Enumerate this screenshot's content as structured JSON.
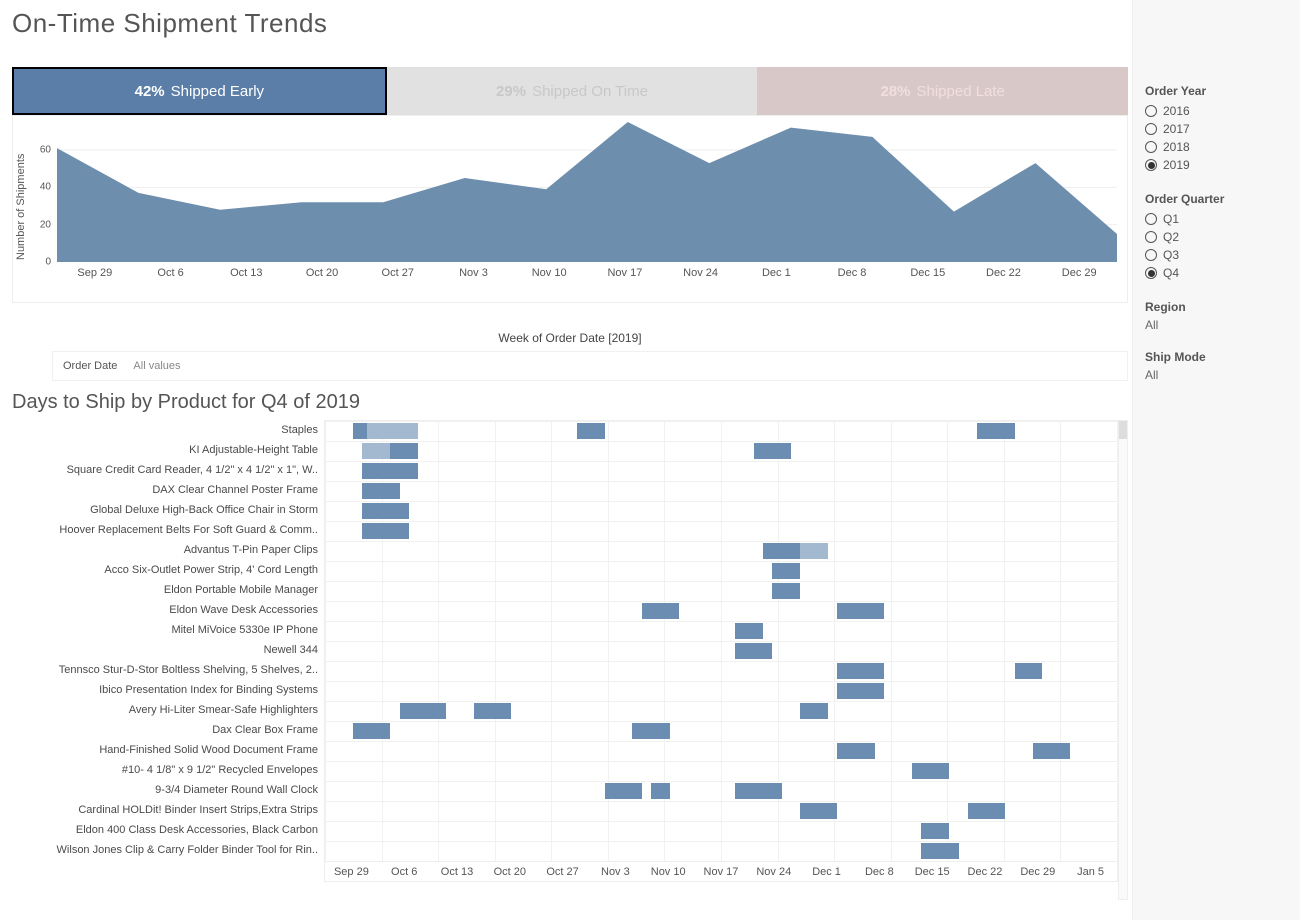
{
  "title": "On-Time Shipment Trends",
  "kpis": {
    "early": {
      "pct": "42%",
      "label": "Shipped Early"
    },
    "ontime": {
      "pct": "29%",
      "label": "Shipped On Time"
    },
    "late": {
      "pct": "28%",
      "label": "Shipped Late"
    }
  },
  "area": {
    "y_title": "Number of Shipments",
    "x_title": "Week of Order Date [2019]",
    "y_ticks": [
      "0",
      "20",
      "40",
      "60"
    ],
    "x_ticks": [
      "Sep 29",
      "Oct 6",
      "Oct 13",
      "Oct 20",
      "Oct 27",
      "Nov 3",
      "Nov 10",
      "Nov 17",
      "Nov 24",
      "Dec 1",
      "Dec 8",
      "Dec 15",
      "Dec 22",
      "Dec 29"
    ]
  },
  "order_date": {
    "label": "Order Date",
    "value": "All values"
  },
  "subtitle": "Days to Ship by Product for Q4 of 2019",
  "gantt_x_ticks": [
    "Sep 29",
    "Oct 6",
    "Oct 13",
    "Oct 20",
    "Oct 27",
    "Nov 3",
    "Nov 10",
    "Nov 17",
    "Nov 24",
    "Dec 1",
    "Dec 8",
    "Dec 15",
    "Dec 22",
    "Dec 29",
    "Jan 5"
  ],
  "gantt": [
    {
      "label": "Staples",
      "bars": [
        {
          "x": 3,
          "w": 6
        },
        {
          "x": 4.5,
          "w": 5.5,
          "light": true
        },
        {
          "x": 27,
          "w": 3
        },
        {
          "x": 70,
          "w": 4
        }
      ]
    },
    {
      "label": "KI Adjustable-Height Table",
      "bars": [
        {
          "x": 4,
          "w": 3,
          "light": true
        },
        {
          "x": 7,
          "w": 3
        },
        {
          "x": 46,
          "w": 4
        }
      ]
    },
    {
      "label": "Square Credit Card Reader, 4 1/2\" x 4 1/2\" x 1\", W..",
      "bars": [
        {
          "x": 4,
          "w": 6
        }
      ]
    },
    {
      "label": "DAX Clear Channel Poster Frame",
      "bars": [
        {
          "x": 4,
          "w": 4
        }
      ]
    },
    {
      "label": "Global Deluxe High-Back Office Chair in Storm",
      "bars": [
        {
          "x": 4,
          "w": 5
        }
      ]
    },
    {
      "label": "Hoover Replacement Belts For Soft Guard & Comm..",
      "bars": [
        {
          "x": 4,
          "w": 5
        }
      ]
    },
    {
      "label": "Advantus T-Pin Paper Clips",
      "bars": [
        {
          "x": 47,
          "w": 4
        },
        {
          "x": 51,
          "w": 3,
          "light": true
        }
      ]
    },
    {
      "label": "Acco Six-Outlet Power Strip, 4' Cord Length",
      "bars": [
        {
          "x": 48,
          "w": 3
        }
      ]
    },
    {
      "label": "Eldon Portable Mobile Manager",
      "bars": [
        {
          "x": 48,
          "w": 3
        }
      ]
    },
    {
      "label": "Eldon Wave Desk Accessories",
      "bars": [
        {
          "x": 34,
          "w": 4
        },
        {
          "x": 55,
          "w": 5
        }
      ]
    },
    {
      "label": "Mitel MiVoice 5330e IP Phone",
      "bars": [
        {
          "x": 44,
          "w": 3
        }
      ]
    },
    {
      "label": "Newell 344",
      "bars": [
        {
          "x": 44,
          "w": 4
        }
      ]
    },
    {
      "label": "Tennsco Stur-D-Stor Boltless Shelving, 5 Shelves, 2..",
      "bars": [
        {
          "x": 55,
          "w": 5
        },
        {
          "x": 74,
          "w": 3
        }
      ]
    },
    {
      "label": "Ibico Presentation Index for Binding Systems",
      "bars": [
        {
          "x": 55,
          "w": 5
        }
      ]
    },
    {
      "label": "Avery Hi-Liter Smear-Safe Highlighters",
      "bars": [
        {
          "x": 8,
          "w": 5
        },
        {
          "x": 16,
          "w": 4
        },
        {
          "x": 51,
          "w": 3
        }
      ]
    },
    {
      "label": "Dax Clear Box Frame",
      "bars": [
        {
          "x": 3,
          "w": 4
        },
        {
          "x": 33,
          "w": 4
        }
      ]
    },
    {
      "label": "Hand-Finished Solid Wood Document Frame",
      "bars": [
        {
          "x": 55,
          "w": 4
        },
        {
          "x": 76,
          "w": 4
        }
      ]
    },
    {
      "label": "#10- 4 1/8\" x 9 1/2\" Recycled Envelopes",
      "bars": [
        {
          "x": 63,
          "w": 4
        }
      ]
    },
    {
      "label": "9-3/4 Diameter Round Wall Clock",
      "bars": [
        {
          "x": 30,
          "w": 4
        },
        {
          "x": 35,
          "w": 2
        },
        {
          "x": 44,
          "w": 5
        }
      ]
    },
    {
      "label": "Cardinal HOLDit! Binder Insert Strips,Extra Strips",
      "bars": [
        {
          "x": 51,
          "w": 4
        },
        {
          "x": 69,
          "w": 4
        }
      ]
    },
    {
      "label": "Eldon 400 Class Desk Accessories, Black Carbon",
      "bars": [
        {
          "x": 64,
          "w": 3
        }
      ]
    },
    {
      "label": "Wilson Jones Clip & Carry Folder Binder Tool for Rin..",
      "bars": [
        {
          "x": 64,
          "w": 4
        }
      ]
    }
  ],
  "filters": {
    "year": {
      "title": "Order Year",
      "options": [
        "2016",
        "2017",
        "2018",
        "2019"
      ],
      "selected": "2019"
    },
    "quarter": {
      "title": "Order Quarter",
      "options": [
        "Q1",
        "Q2",
        "Q3",
        "Q4"
      ],
      "selected": "Q4"
    },
    "region": {
      "title": "Region",
      "value": "All"
    },
    "shipmode": {
      "title": "Ship Mode",
      "value": "All"
    }
  },
  "chart_data": {
    "type": "area",
    "title": "Number of Shipments (Shipped Early) by Week of Order Date, Q4 2019",
    "xlabel": "Week of Order Date [2019]",
    "ylabel": "Number of Shipments",
    "ylim": [
      0,
      75
    ],
    "categories": [
      "Sep 29",
      "Oct 6",
      "Oct 13",
      "Oct 20",
      "Oct 27",
      "Nov 3",
      "Nov 10",
      "Nov 17",
      "Nov 24",
      "Dec 1",
      "Dec 8",
      "Dec 15",
      "Dec 22",
      "Dec 29"
    ],
    "values": [
      61,
      37,
      28,
      32,
      32,
      45,
      39,
      75,
      53,
      72,
      67,
      27,
      53,
      15
    ]
  }
}
